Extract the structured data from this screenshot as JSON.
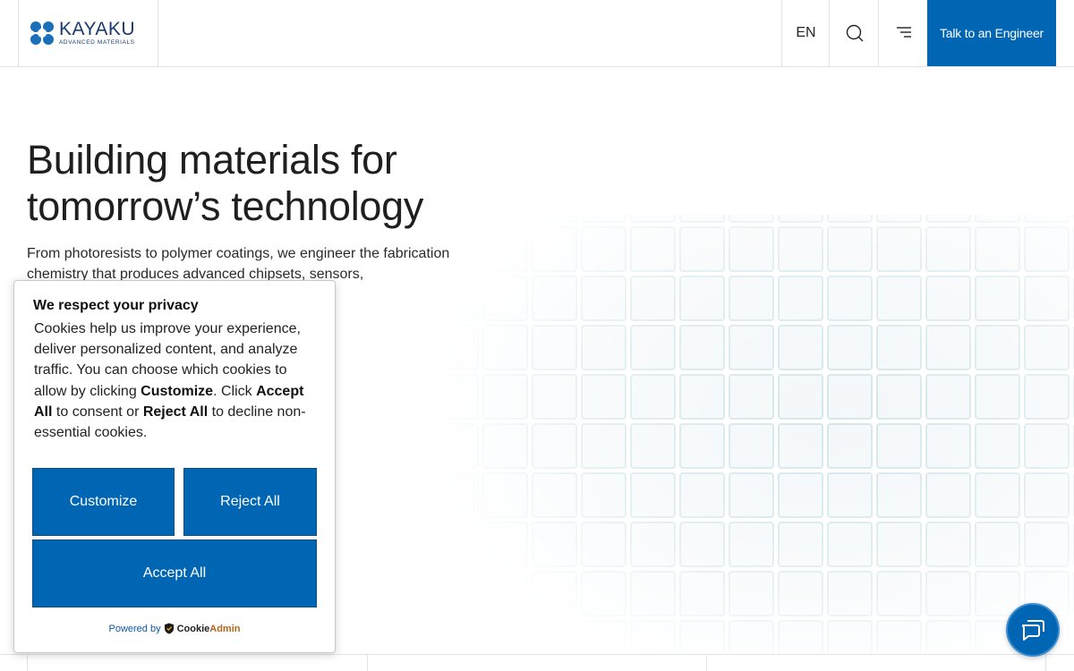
{
  "header": {
    "logo_name": "KAYAKU",
    "logo_sub": "ADVANCED MATERIALS",
    "lang": "EN",
    "cta_label": "Talk to an Engineer",
    "icons": {
      "search": "search-icon",
      "menu": "menu-icon"
    }
  },
  "hero": {
    "title": "Building materials for tomorrow’s technology",
    "description": "From photoresists to polymer coatings, we engineer the fabrication chemistry that produces advanced chipsets, sensors,",
    "fragment": ","
  },
  "cookie": {
    "title": "We respect your privacy",
    "body_1": "Cookies help us improve your experience, deliver personalized content, and analyze traffic. You can choose which cookies to allow by clicking ",
    "bold_customize": "Customize",
    "body_2": ". Click ",
    "bold_accept": "Accept All",
    "body_3": " to consent or ",
    "bold_reject": "Reject All",
    "body_4": " to decline non-essential cookies.",
    "customize_label": "Customize",
    "reject_label": "Reject All",
    "accept_label": "Accept All",
    "powered_by": "Powered by",
    "brand_cookie": "Cookie",
    "brand_admin": "Admin"
  },
  "colors": {
    "accent": "#0066b3",
    "logo": "#1b3b6f"
  },
  "chat": {
    "icon": "chat-icon"
  }
}
